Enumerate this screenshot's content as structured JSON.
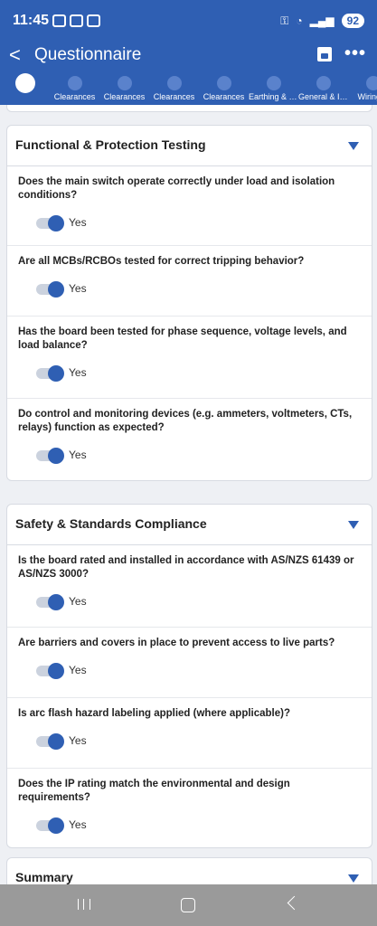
{
  "status": {
    "time": "11:45",
    "battery": "92"
  },
  "appbar": {
    "title": "Questionnaire"
  },
  "tabs": [
    "",
    "Clearances",
    "Clearances",
    "Clearances",
    "Clearances",
    "Earthing & B...",
    "General & In...",
    "Wiring &"
  ],
  "sections": [
    {
      "title": "Functional & Protection Testing",
      "questions": [
        {
          "text": "Does the main switch operate correctly under load and isolation conditions?",
          "answer": "Yes"
        },
        {
          "text": "Are all MCBs/RCBOs tested for correct tripping behavior?",
          "answer": "Yes"
        },
        {
          "text": "Has the board been tested for phase sequence, voltage levels, and load balance?",
          "answer": "Yes"
        },
        {
          "text": "Do control and monitoring devices (e.g. ammeters, voltmeters, CTs, relays) function as expected?",
          "answer": "Yes"
        }
      ]
    },
    {
      "title": "Safety & Standards Compliance",
      "questions": [
        {
          "text": "Is the board rated and installed in accordance with AS/NZS 61439 or AS/NZS 3000?",
          "answer": "Yes"
        },
        {
          "text": "Are barriers and covers in place to prevent access to live parts?",
          "answer": "Yes"
        },
        {
          "text": "Is arc flash hazard labeling applied (where applicable)?",
          "answer": "Yes"
        },
        {
          "text": "Does the IP rating match the environmental and design requirements?",
          "answer": "Yes"
        }
      ]
    },
    {
      "title": "Summary",
      "questions": []
    }
  ]
}
